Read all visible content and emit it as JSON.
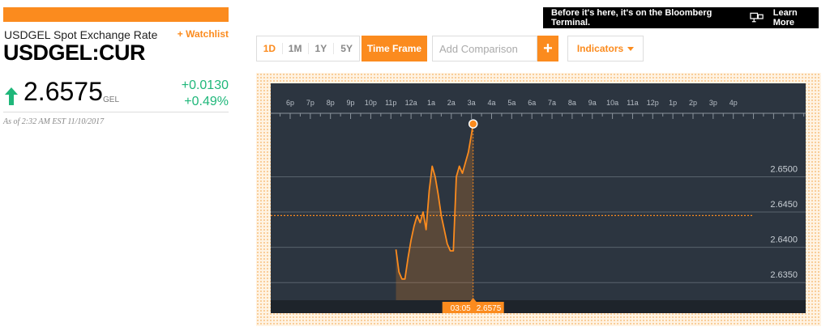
{
  "quote": {
    "name": "USDGEL Spot Exchange Rate",
    "watchlist_label": "+ Watchlist",
    "ticker": "USDGEL:CUR",
    "price": "2.6575",
    "currency": "GEL",
    "change_abs": "+0.0130",
    "change_pct": "+0.49%",
    "as_of": "As of 2:32 AM EST 11/10/2017"
  },
  "promo": {
    "text": "Before it's here, it's on the Bloomberg Terminal.",
    "learn_more": "Learn More"
  },
  "controls": {
    "ranges": [
      {
        "label": "1D",
        "active": true
      },
      {
        "label": "1M",
        "active": false
      },
      {
        "label": "1Y",
        "active": false
      },
      {
        "label": "5Y",
        "active": false
      }
    ],
    "timeframe_label": "Time Frame",
    "comparison_placeholder": "Add Comparison",
    "add_label": "+",
    "indicators_label": "Indicators"
  },
  "colors": {
    "accent": "#fb8b1e",
    "positive": "#1fb77a",
    "chart_bg": "#2c3540",
    "chart_axis_bg": "#1e242b"
  },
  "chart_data": {
    "type": "area",
    "x_tick_labels": [
      "6p",
      "7p",
      "8p",
      "9p",
      "10p",
      "11p",
      "12a",
      "1a",
      "2a",
      "3a",
      "4a",
      "5a",
      "6a",
      "7a",
      "8a",
      "9a",
      "10a",
      "11a",
      "12p",
      "1p",
      "2p",
      "3p",
      "4p"
    ],
    "x_hours_from_6p": [
      5.25,
      5.4,
      5.55,
      5.7,
      5.85,
      6.0,
      6.15,
      6.3,
      6.45,
      6.6,
      6.75,
      6.9,
      7.05,
      7.2,
      7.35,
      7.5,
      7.65,
      7.8,
      7.95,
      8.1,
      8.25,
      8.4,
      8.55,
      8.7,
      8.85,
      9.0,
      9.083
    ],
    "y": [
      2.6397,
      2.6365,
      2.6355,
      2.6355,
      2.6385,
      2.641,
      2.643,
      2.6445,
      2.6435,
      2.645,
      2.6425,
      2.648,
      2.6515,
      2.65,
      2.6475,
      2.6445,
      2.6425,
      2.6405,
      2.6395,
      2.6395,
      2.65,
      2.6515,
      2.6505,
      2.652,
      2.6535,
      2.656,
      2.6575
    ],
    "y_tick_labels": [
      "2.6500",
      "2.6450",
      "2.6400",
      "2.6350"
    ],
    "y_ticks": [
      2.65,
      2.645,
      2.64,
      2.635
    ],
    "ylim": [
      2.6325,
      2.659
    ],
    "reference_line": 2.6445,
    "cursor": {
      "time": "03:05",
      "value": "2.6575"
    },
    "grid": true
  }
}
